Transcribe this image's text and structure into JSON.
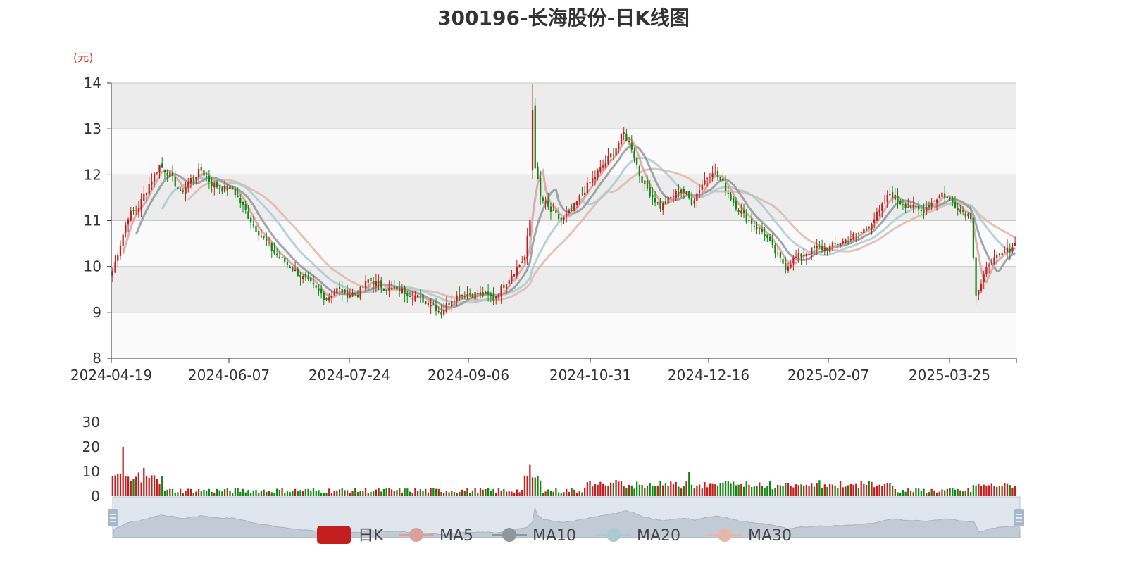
{
  "title": "300196-长海股份-日K线图",
  "colors": {
    "up": "#c41e1e",
    "down": "#118811",
    "ma5": "#d9a19a",
    "ma10": "#8e979e",
    "ma20": "#a9cbd1",
    "ma30": "#e3b8a9",
    "grid": "#c8c8c8",
    "band_dark": "#ececec",
    "band_light": "#fafafa",
    "slider_bg": "#d6dde8",
    "unit": "#e03030"
  },
  "chart_data": [
    {
      "type": "candlestick",
      "unit": "(元)",
      "y_ticks": [
        "8",
        "9",
        "10",
        "11",
        "12",
        "13",
        "14"
      ],
      "ylim": [
        8,
        14
      ],
      "x_ticks": [
        "2024-04-19",
        "2024-06-07",
        "2024-07-24",
        "2024-09-06",
        "2024-10-31",
        "2024-12-16",
        "2025-02-07",
        "2025-03-25"
      ],
      "grid": true,
      "series_close_keyframes": [
        [
          0,
          9.9
        ],
        [
          3,
          10.5
        ],
        [
          6,
          11.1
        ],
        [
          10,
          11.3
        ],
        [
          14,
          11.8
        ],
        [
          18,
          12.2
        ],
        [
          22,
          12.0
        ],
        [
          26,
          11.6
        ],
        [
          30,
          11.9
        ],
        [
          34,
          12.1
        ],
        [
          38,
          11.8
        ],
        [
          42,
          11.7
        ],
        [
          46,
          11.7
        ],
        [
          50,
          11.3
        ],
        [
          54,
          10.9
        ],
        [
          58,
          10.6
        ],
        [
          62,
          10.3
        ],
        [
          66,
          10.1
        ],
        [
          70,
          9.9
        ],
        [
          74,
          9.7
        ],
        [
          78,
          9.5
        ],
        [
          82,
          9.3
        ],
        [
          86,
          9.5
        ],
        [
          90,
          9.4
        ],
        [
          94,
          9.4
        ],
        [
          98,
          9.7
        ],
        [
          102,
          9.6
        ],
        [
          106,
          9.5
        ],
        [
          110,
          9.5
        ],
        [
          114,
          9.4
        ],
        [
          118,
          9.3
        ],
        [
          122,
          9.2
        ],
        [
          126,
          9.0
        ],
        [
          130,
          9.3
        ],
        [
          134,
          9.4
        ],
        [
          138,
          9.4
        ],
        [
          142,
          9.4
        ],
        [
          146,
          9.3
        ],
        [
          150,
          9.6
        ],
        [
          154,
          9.9
        ],
        [
          158,
          10.2
        ],
        [
          160,
          11.0
        ],
        [
          161,
          13.5
        ],
        [
          162,
          12.2
        ],
        [
          164,
          11.5
        ],
        [
          168,
          11.2
        ],
        [
          172,
          11.0
        ],
        [
          176,
          11.2
        ],
        [
          180,
          11.6
        ],
        [
          184,
          11.9
        ],
        [
          188,
          12.2
        ],
        [
          192,
          12.5
        ],
        [
          196,
          12.9
        ],
        [
          199,
          12.6
        ],
        [
          202,
          12.0
        ],
        [
          206,
          11.6
        ],
        [
          210,
          11.3
        ],
        [
          214,
          11.5
        ],
        [
          218,
          11.7
        ],
        [
          222,
          11.4
        ],
        [
          226,
          11.8
        ],
        [
          230,
          12.1
        ],
        [
          234,
          11.8
        ],
        [
          238,
          11.4
        ],
        [
          242,
          11.1
        ],
        [
          246,
          10.9
        ],
        [
          250,
          10.7
        ],
        [
          254,
          10.3
        ],
        [
          258,
          10.0
        ],
        [
          262,
          10.2
        ],
        [
          266,
          10.3
        ],
        [
          270,
          10.4
        ],
        [
          274,
          10.4
        ],
        [
          278,
          10.5
        ],
        [
          282,
          10.6
        ],
        [
          286,
          10.7
        ],
        [
          290,
          10.9
        ],
        [
          294,
          11.2
        ],
        [
          298,
          11.6
        ],
        [
          302,
          11.4
        ],
        [
          306,
          11.3
        ],
        [
          310,
          11.2
        ],
        [
          314,
          11.4
        ],
        [
          318,
          11.6
        ],
        [
          322,
          11.4
        ],
        [
          326,
          11.2
        ],
        [
          329,
          11.1
        ],
        [
          331,
          9.4
        ],
        [
          333,
          9.6
        ],
        [
          336,
          10.1
        ],
        [
          340,
          10.2
        ],
        [
          344,
          10.4
        ],
        [
          346,
          10.5
        ]
      ]
    },
    {
      "type": "bar",
      "name": "volume",
      "y_ticks": [
        "0",
        "10",
        "20",
        "30"
      ],
      "ylim": [
        0,
        30
      ]
    }
  ],
  "legend": [
    {
      "key": "kline",
      "label": "日K"
    },
    {
      "key": "ma5",
      "label": "MA5"
    },
    {
      "key": "ma10",
      "label": "MA10"
    },
    {
      "key": "ma20",
      "label": "MA20"
    },
    {
      "key": "ma30",
      "label": "MA30"
    }
  ]
}
